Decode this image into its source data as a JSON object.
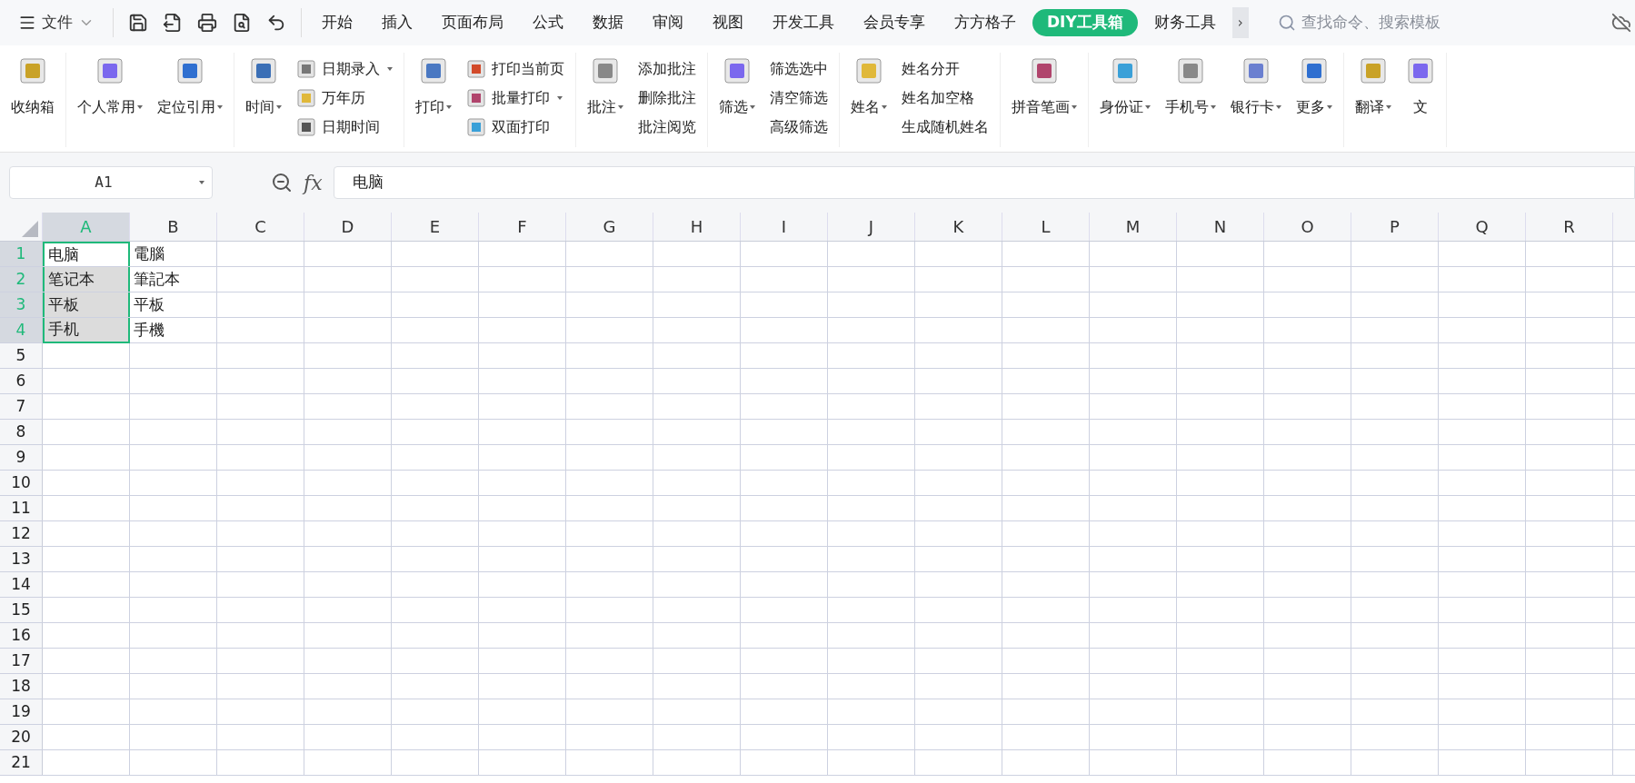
{
  "menu": {
    "label": "文件"
  },
  "tabs": [
    {
      "label": "开始",
      "selected": false
    },
    {
      "label": "插入",
      "selected": false
    },
    {
      "label": "页面布局",
      "selected": false
    },
    {
      "label": "公式",
      "selected": false
    },
    {
      "label": "数据",
      "selected": false
    },
    {
      "label": "审阅",
      "selected": false
    },
    {
      "label": "视图",
      "selected": false
    },
    {
      "label": "开发工具",
      "selected": false
    },
    {
      "label": "会员专享",
      "selected": false
    },
    {
      "label": "方方格子",
      "selected": false
    },
    {
      "label": "DIY工具箱",
      "selected": true
    },
    {
      "label": "财务工具",
      "selected": false
    }
  ],
  "more_tabs": "›",
  "search": {
    "placeholder": "查找命令、搜索模板"
  },
  "ribbon": [
    {
      "items": [
        {
          "kind": "large",
          "label": "收纳箱",
          "caret": false
        }
      ]
    },
    {
      "items": [
        {
          "kind": "large",
          "label": "个人常用",
          "caret": true
        },
        {
          "kind": "large",
          "label": "定位引用",
          "caret": true
        }
      ]
    },
    {
      "items": [
        {
          "kind": "large",
          "label": "时间",
          "caret": true
        },
        {
          "kind": "stack",
          "entries": [
            {
              "label": "日期录入",
              "caret": true,
              "icon": true
            },
            {
              "label": "万年历",
              "caret": false,
              "icon": true
            },
            {
              "label": "日期时间",
              "caret": false,
              "icon": true
            }
          ]
        }
      ]
    },
    {
      "items": [
        {
          "kind": "large",
          "label": "打印",
          "caret": true
        },
        {
          "kind": "stack",
          "entries": [
            {
              "label": "打印当前页",
              "caret": false,
              "icon": true
            },
            {
              "label": "批量打印",
              "caret": true,
              "icon": true
            },
            {
              "label": "双面打印",
              "caret": false,
              "icon": true
            }
          ]
        }
      ]
    },
    {
      "items": [
        {
          "kind": "large",
          "label": "批注",
          "caret": true
        },
        {
          "kind": "stack",
          "entries": [
            {
              "label": "添加批注",
              "caret": false,
              "icon": false
            },
            {
              "label": "删除批注",
              "caret": false,
              "icon": false
            },
            {
              "label": "批注阅览",
              "caret": false,
              "icon": false
            }
          ]
        }
      ]
    },
    {
      "items": [
        {
          "kind": "large",
          "label": "筛选",
          "caret": true
        },
        {
          "kind": "stack",
          "entries": [
            {
              "label": "筛选选中",
              "caret": false,
              "icon": false
            },
            {
              "label": "清空筛选",
              "caret": false,
              "icon": false
            },
            {
              "label": "高级筛选",
              "caret": false,
              "icon": false
            }
          ]
        }
      ]
    },
    {
      "items": [
        {
          "kind": "large",
          "label": "姓名",
          "caret": true
        },
        {
          "kind": "stack",
          "entries": [
            {
              "label": "姓名分开",
              "caret": false,
              "icon": false
            },
            {
              "label": "姓名加空格",
              "caret": false,
              "icon": false
            },
            {
              "label": "生成随机姓名",
              "caret": false,
              "icon": false
            }
          ]
        }
      ]
    },
    {
      "items": [
        {
          "kind": "large",
          "label": "拼音笔画",
          "caret": true
        }
      ]
    },
    {
      "items": [
        {
          "kind": "large",
          "label": "身份证",
          "caret": true
        },
        {
          "kind": "large",
          "label": "手机号",
          "caret": true
        },
        {
          "kind": "large",
          "label": "银行卡",
          "caret": true
        },
        {
          "kind": "large",
          "label": "更多",
          "caret": true
        }
      ]
    },
    {
      "items": [
        {
          "kind": "large",
          "label": "翻译",
          "caret": true
        },
        {
          "kind": "large",
          "label": "文",
          "caret": false
        }
      ]
    }
  ],
  "name_box": "A1",
  "formula_label": "fx",
  "formula": "电脑",
  "columns": [
    {
      "label": "A",
      "selected": true
    },
    {
      "label": "B",
      "selected": false
    },
    {
      "label": "C",
      "selected": false
    },
    {
      "label": "D",
      "selected": false
    },
    {
      "label": "E",
      "selected": false
    },
    {
      "label": "F",
      "selected": false
    },
    {
      "label": "G",
      "selected": false
    },
    {
      "label": "H",
      "selected": false
    },
    {
      "label": "I",
      "selected": false
    },
    {
      "label": "J",
      "selected": false
    },
    {
      "label": "K",
      "selected": false
    },
    {
      "label": "L",
      "selected": false
    },
    {
      "label": "M",
      "selected": false
    },
    {
      "label": "N",
      "selected": false
    },
    {
      "label": "O",
      "selected": false
    },
    {
      "label": "P",
      "selected": false
    },
    {
      "label": "Q",
      "selected": false
    },
    {
      "label": "R",
      "selected": false
    }
  ],
  "rows": [
    {
      "label": "1",
      "selected": true,
      "cells": [
        {
          "text": "电脑",
          "selected": true,
          "active": true
        },
        {
          "text": "電腦",
          "selected": false,
          "active": false
        }
      ]
    },
    {
      "label": "2",
      "selected": true,
      "cells": [
        {
          "text": "笔记本",
          "selected": true,
          "active": false
        },
        {
          "text": "筆記本",
          "selected": false,
          "active": false
        }
      ]
    },
    {
      "label": "3",
      "selected": true,
      "cells": [
        {
          "text": "平板",
          "selected": true,
          "active": false
        },
        {
          "text": "平板",
          "selected": false,
          "active": false
        }
      ]
    },
    {
      "label": "4",
      "selected": true,
      "cells": [
        {
          "text": "手机",
          "selected": true,
          "active": false
        },
        {
          "text": "手機",
          "selected": false,
          "active": false
        }
      ]
    },
    {
      "label": "5",
      "selected": false,
      "cells": []
    },
    {
      "label": "6",
      "selected": false,
      "cells": []
    },
    {
      "label": "7",
      "selected": false,
      "cells": []
    },
    {
      "label": "8",
      "selected": false,
      "cells": []
    },
    {
      "label": "9",
      "selected": false,
      "cells": []
    },
    {
      "label": "10",
      "selected": false,
      "cells": []
    },
    {
      "label": "11",
      "selected": false,
      "cells": []
    },
    {
      "label": "12",
      "selected": false,
      "cells": []
    },
    {
      "label": "13",
      "selected": false,
      "cells": []
    },
    {
      "label": "14",
      "selected": false,
      "cells": []
    },
    {
      "label": "15",
      "selected": false,
      "cells": []
    },
    {
      "label": "16",
      "selected": false,
      "cells": []
    },
    {
      "label": "17",
      "selected": false,
      "cells": []
    },
    {
      "label": "18",
      "selected": false,
      "cells": []
    },
    {
      "label": "19",
      "selected": false,
      "cells": []
    },
    {
      "label": "20",
      "selected": false,
      "cells": []
    },
    {
      "label": "21",
      "selected": false,
      "cells": []
    }
  ]
}
